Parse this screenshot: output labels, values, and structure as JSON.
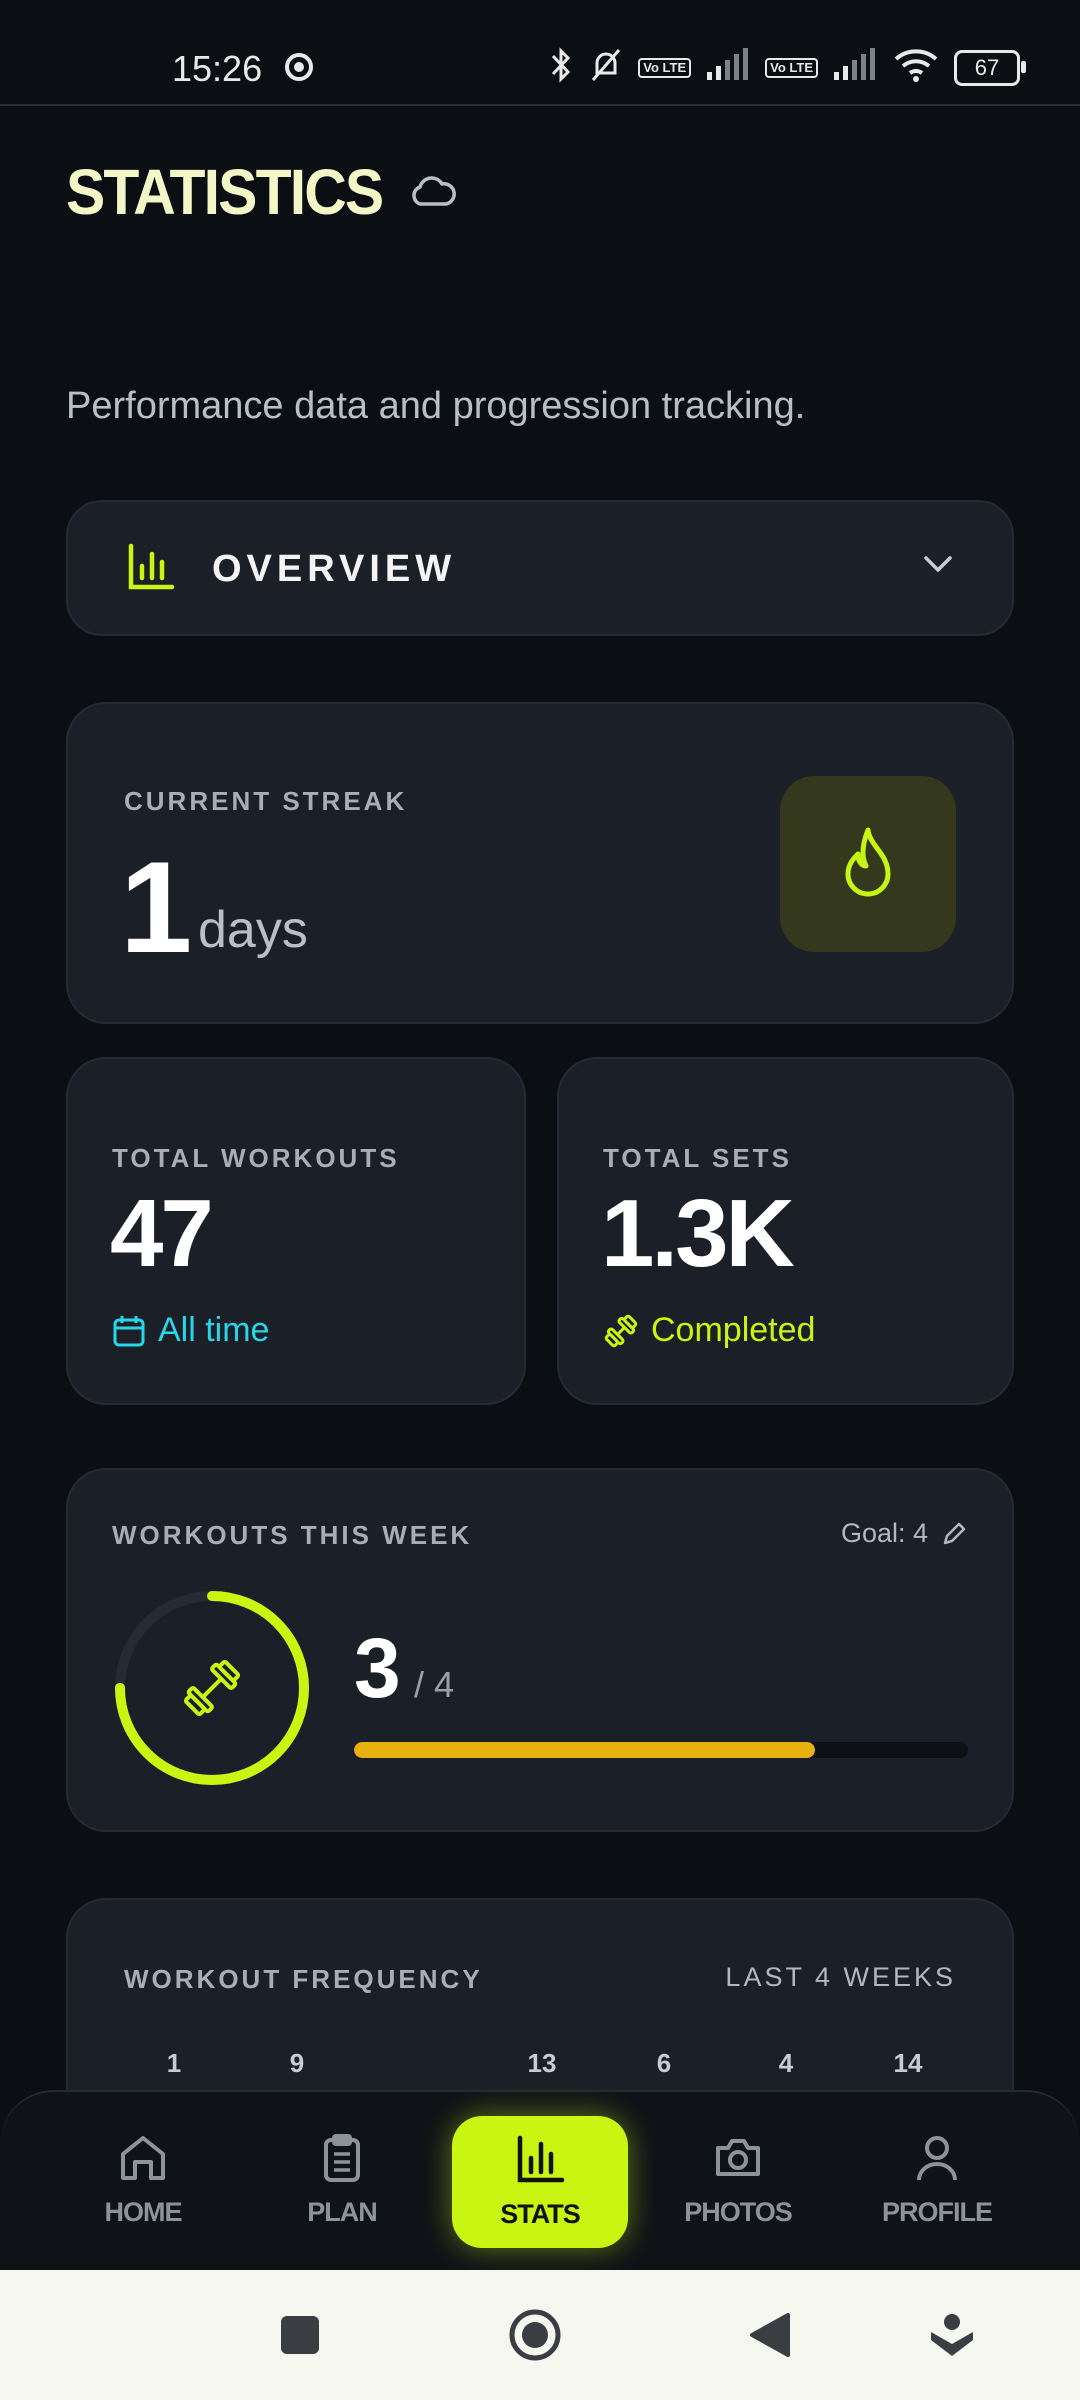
{
  "status_bar": {
    "time": "15:26",
    "battery": "67",
    "volte1": "Vo LTE",
    "volte2": "Vo LTE"
  },
  "header": {
    "title": "STATISTICS",
    "subtitle": "Performance data and progression tracking."
  },
  "section_selector": {
    "label": "OVERVIEW"
  },
  "streak": {
    "label": "CURRENT STREAK",
    "value": "1",
    "unit": "days"
  },
  "total_workouts": {
    "label": "TOTAL WORKOUTS",
    "value": "47",
    "meta": "All time"
  },
  "total_sets": {
    "label": "TOTAL SETS",
    "value": "1.3K",
    "meta": "Completed"
  },
  "weekly": {
    "label": "WORKOUTS THIS WEEK",
    "goal": "Goal: 4",
    "count": "3",
    "target": "/ 4",
    "progress_fraction": 0.75
  },
  "frequency": {
    "label": "WORKOUT FREQUENCY",
    "range": "LAST 4 WEEKS",
    "values": [
      "1",
      "9",
      "13",
      "6",
      "4",
      "14"
    ]
  },
  "nav": {
    "home": "HOME",
    "plan": "PLAN",
    "stats": "STATS",
    "photos": "PHOTOS",
    "profile": "PROFILE"
  },
  "colors": {
    "accent": "#c8f511",
    "cyan": "#27d6e8",
    "progress": "#e8b10f",
    "background": "#0b0e13",
    "card": "#1b1f27"
  }
}
